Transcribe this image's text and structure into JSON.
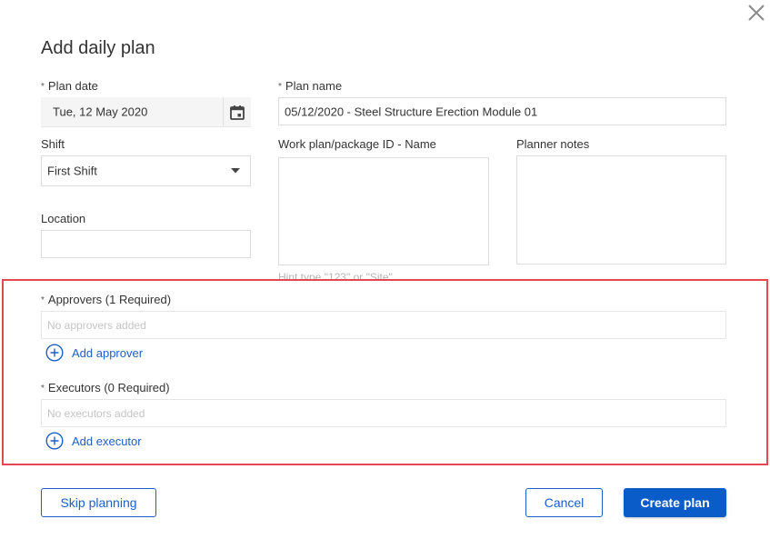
{
  "dialog": {
    "title": "Add daily plan",
    "close_icon": "close-icon"
  },
  "plan_date": {
    "required_mark": "*",
    "label": "Plan date",
    "value": "Tue, 12 May 2020",
    "icon": "calendar-icon"
  },
  "plan_name": {
    "required_mark": "*",
    "label": "Plan name",
    "value": "05/12/2020 - Steel Structure Erection Module 01"
  },
  "shift": {
    "label": "Shift",
    "selected": "First Shift",
    "icon": "caret-down-icon"
  },
  "work_plan": {
    "label": "Work plan/package ID - Name",
    "value": "",
    "hint": "Hint type \"123\" or \"Site\""
  },
  "planner_notes": {
    "label": "Planner notes",
    "value": ""
  },
  "location": {
    "label": "Location",
    "value": ""
  },
  "approvers": {
    "required_mark": "*",
    "label": "Approvers (1 Required)",
    "empty_text": "No approvers added",
    "add_label": "Add approver",
    "add_icon": "plus-circle-icon"
  },
  "executors": {
    "required_mark": "*",
    "label": "Executors (0 Required)",
    "empty_text": "No executors added",
    "add_label": "Add executor",
    "add_icon": "plus-circle-icon"
  },
  "footer": {
    "skip_label": "Skip planning",
    "cancel_label": "Cancel",
    "create_label": "Create plan"
  },
  "colors": {
    "accent": "#1e5ec8",
    "primary_button": "#0a5dc9",
    "highlight_border": "#e4474f",
    "field_border": "#dcdcdc",
    "placeholder": "#c4c4c4"
  }
}
